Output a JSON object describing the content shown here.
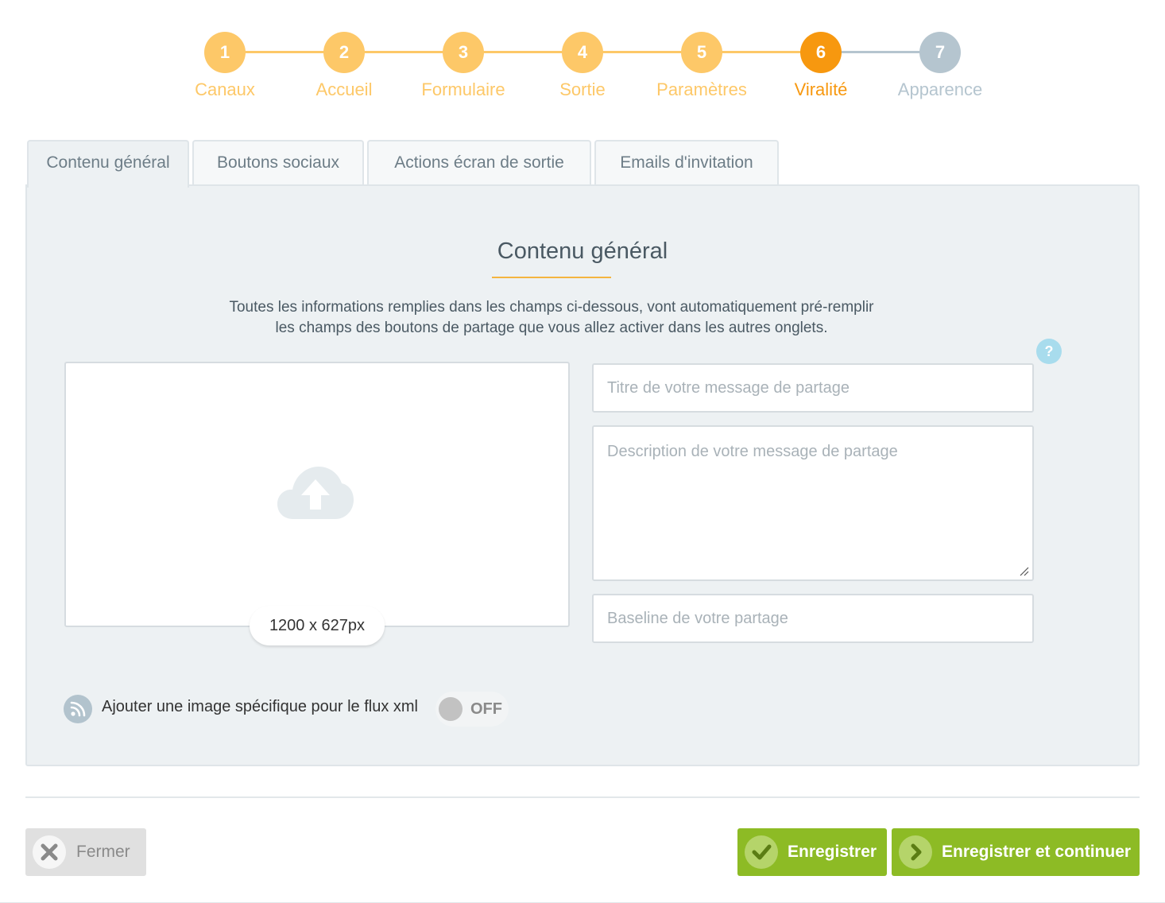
{
  "stepper": {
    "steps": [
      {
        "number": "1",
        "label": "Canaux",
        "state": "done"
      },
      {
        "number": "2",
        "label": "Accueil",
        "state": "done"
      },
      {
        "number": "3",
        "label": "Formulaire",
        "state": "done"
      },
      {
        "number": "4",
        "label": "Sortie",
        "state": "done"
      },
      {
        "number": "5",
        "label": "Paramètres",
        "state": "done"
      },
      {
        "number": "6",
        "label": "Viralité",
        "state": "current"
      },
      {
        "number": "7",
        "label": "Apparence",
        "state": "upcoming"
      }
    ],
    "colors": {
      "done": "#fdc868",
      "current": "#f7980f",
      "upcoming": "#b5c5cf"
    }
  },
  "tabs": [
    {
      "label": "Contenu général",
      "active": true
    },
    {
      "label": "Boutons sociaux",
      "active": false
    },
    {
      "label": "Actions écran de sortie",
      "active": false
    },
    {
      "label": "Emails d'invitation",
      "active": false
    }
  ],
  "panel": {
    "title": "Contenu général",
    "description_line1": "Toutes les informations remplies dans les champs ci-dessous, vont automatiquement pré-remplir",
    "description_line2": "les champs des boutons de partage que vous allez activer dans les autres onglets.",
    "help_label": "?",
    "image_size": "1200 x 627px",
    "title_placeholder": "Titre de votre message de partage",
    "description_placeholder": "Description de votre message de partage",
    "baseline_placeholder": "Baseline de votre partage",
    "xml_label": "Ajouter une image spécifique pour le flux xml",
    "toggle_state": "OFF"
  },
  "footer": {
    "close_label": "Fermer",
    "save_label": "Enregistrer",
    "save_continue_label": "Enregistrer et continuer"
  },
  "accent_color": "#f4b53f",
  "button_color": "#8dbb25",
  "icons": [
    "cloud-upload-icon",
    "help-icon",
    "rss-icon",
    "close-icon",
    "check-icon",
    "chevron-right-icon"
  ]
}
